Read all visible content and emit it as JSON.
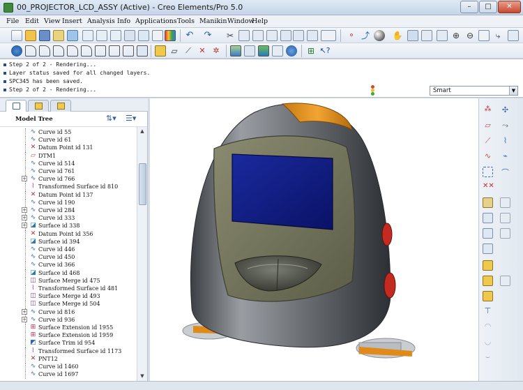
{
  "window": {
    "title": "00_PROJECTOR_LCD_ASSY (Active) - Creo Elements/Pro 5.0",
    "minimize": "–",
    "maximize": "□",
    "close": "✕"
  },
  "menu": [
    "File",
    "Edit",
    "View",
    "Insert",
    "Analysis",
    "Info",
    "Applications",
    "Tools",
    "Manikin",
    "Window",
    "Help"
  ],
  "messages": [
    "Step 2 of 2 - Rendering...",
    "Layer status saved for all changed layers.",
    "SPC345 has been saved.",
    "Step 2 of 2 - Rendering..."
  ],
  "filter": {
    "selected": "Smart"
  },
  "model_tree": {
    "title": "Model Tree",
    "items": [
      {
        "label": "Curve id 55",
        "icon": "curve-icon",
        "expander": false
      },
      {
        "label": "Curve id 61",
        "icon": "curve-icon",
        "expander": false
      },
      {
        "label": "Datum Point id 131",
        "icon": "datum-point-icon",
        "expander": false
      },
      {
        "label": "DTM1",
        "icon": "datum-plane-icon",
        "expander": false
      },
      {
        "label": "Curve id 514",
        "icon": "curve-icon",
        "expander": false
      },
      {
        "label": "Curve id 761",
        "icon": "curve-icon",
        "expander": false
      },
      {
        "label": "Curve id 766",
        "icon": "curve-icon",
        "expander": true
      },
      {
        "label": "Transformed Surface id 810",
        "icon": "transformed-surface-icon",
        "expander": false
      },
      {
        "label": "Datum Point id 137",
        "icon": "datum-point-icon",
        "expander": false
      },
      {
        "label": "Curve id 190",
        "icon": "curve-icon",
        "expander": false
      },
      {
        "label": "Curve id 284",
        "icon": "curve-icon",
        "expander": true
      },
      {
        "label": "Curve id 333",
        "icon": "curve-icon",
        "expander": true
      },
      {
        "label": "Surface id 338",
        "icon": "surface-icon",
        "expander": true
      },
      {
        "label": "Datum Point id 356",
        "icon": "datum-point-icon",
        "expander": false
      },
      {
        "label": "Surface id 394",
        "icon": "surface-icon",
        "expander": false
      },
      {
        "label": "Curve id 446",
        "icon": "curve-icon",
        "expander": false
      },
      {
        "label": "Curve id 450",
        "icon": "curve-icon",
        "expander": false
      },
      {
        "label": "Curve id 366",
        "icon": "curve-icon",
        "expander": false
      },
      {
        "label": "Surface id 468",
        "icon": "surface-icon",
        "expander": false
      },
      {
        "label": "Surface Merge id 475",
        "icon": "surface-merge-icon",
        "expander": false
      },
      {
        "label": "Transformed Surface id 481",
        "icon": "transformed-surface-icon",
        "expander": false
      },
      {
        "label": "Surface Merge id 493",
        "icon": "surface-merge-icon",
        "expander": false
      },
      {
        "label": "Surface Merge id 504",
        "icon": "surface-merge-icon",
        "expander": false
      },
      {
        "label": "Curve id 816",
        "icon": "curve-icon",
        "expander": true
      },
      {
        "label": "Curve id 936",
        "icon": "curve-icon",
        "expander": true
      },
      {
        "label": "Surface Extension id 1955",
        "icon": "surface-extension-icon",
        "expander": false
      },
      {
        "label": "Surface Extension id 1959",
        "icon": "surface-extension-icon",
        "expander": false
      },
      {
        "label": "Surface Trim id 954",
        "icon": "surface-trim-icon",
        "expander": false
      },
      {
        "label": "Transformed Surface id 1173",
        "icon": "transformed-surface-icon",
        "expander": false
      },
      {
        "label": "PNT12",
        "icon": "datum-point-icon",
        "expander": false
      },
      {
        "label": "Curve id 1460",
        "icon": "curve-icon",
        "expander": false
      },
      {
        "label": "Curve id 1697",
        "icon": "curve-icon",
        "expander": false
      }
    ]
  },
  "colors": {
    "accent_orange": "#e8961e",
    "screen_blue": "#0f1a86",
    "body_gray": "#7c8085"
  }
}
